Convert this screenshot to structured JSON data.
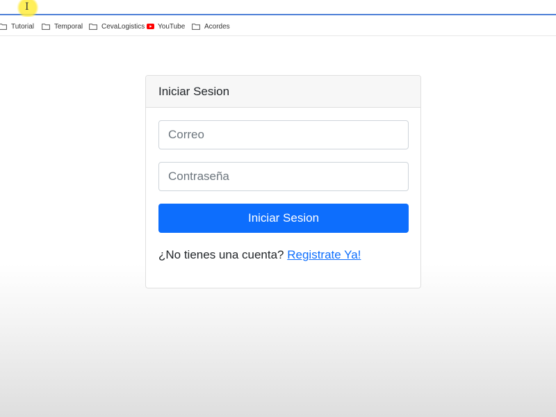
{
  "browser": {
    "bookmarks": [
      {
        "label": "Tutorial",
        "icon": "folder-icon"
      },
      {
        "label": "Temporal",
        "icon": "folder-icon"
      },
      {
        "label": "CevaLogistics",
        "icon": "folder-icon"
      },
      {
        "label": "YouTube",
        "icon": "youtube-icon"
      },
      {
        "label": "Acordes",
        "icon": "folder-icon"
      }
    ],
    "text_cursor": "I"
  },
  "login": {
    "header_title": "Iniciar Sesion",
    "email_placeholder": "Correo",
    "password_placeholder": "Contraseña",
    "submit_label": "Iniciar Sesion",
    "register_prompt": "¿No tienes una cuenta?",
    "register_link": "Registrate Ya!"
  },
  "colors": {
    "primary": "#0d6efd",
    "address_bar_underline": "#4d7fd6",
    "youtube_red": "#ff0000",
    "cursor_highlight": "#ffeb3c"
  }
}
